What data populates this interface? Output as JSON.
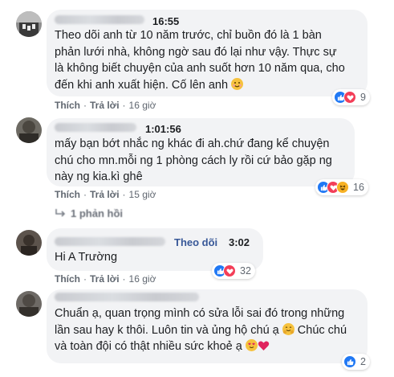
{
  "comments": [
    {
      "time": "16:55",
      "lines": [
        "Theo dõi anh từ 10 năm trước, chỉ buồn đó là 1 bàn",
        "phản lưới nhà, không ngờ sau đó lại như vậy. Thực sự",
        "là không biết chuyện của anh suốt hơn 10 năm qua, cho",
        "đến khi anh xuất hiện. Cố lên anh"
      ],
      "like_label": "Thích",
      "reply_label": "Trả lời",
      "age": "16 giờ",
      "reaction_count": "9",
      "reactions": [
        "like-icon",
        "love-icon"
      ]
    },
    {
      "time": "1:01:56",
      "lines": [
        "mấy bạn bớt nhắc ng khác đi ah.chứ đang kể chuyện",
        "chú cho mn.mỗi ng 1 phòng cách ly rồi cứ bảo gặp ng",
        "này ng kia.kì ghê"
      ],
      "like_label": "Thích",
      "reply_label": "Trả lời",
      "age": "15 giờ",
      "reaction_count": "16",
      "reactions": [
        "like-icon",
        "love-icon",
        "haha-icon"
      ],
      "replies_label": "1 phản hồi"
    },
    {
      "follow_label": "Theo dõi",
      "time": "3:02",
      "lines": [
        "Hi A Trường"
      ],
      "like_label": "Thích",
      "reply_label": "Trả lời",
      "age": "16 giờ",
      "reaction_count": "32",
      "reactions": [
        "like-icon",
        "love-icon"
      ]
    },
    {
      "lines": [
        "Chuẩn ạ, quan trọng mình có sửa lỗi sai đó trong những",
        "lần sau hay k thôi. Luôn tin và ủng hộ chú ạ",
        "và toàn đội có thật nhiều sức khoẻ ạ"
      ],
      "line2_suffix": "Chúc chú",
      "reaction_count": "2",
      "reactions": [
        "like-icon"
      ]
    }
  ],
  "colors": {
    "bubble": "#f2f3f5",
    "link": "#385898",
    "like": "#2078f4",
    "love": "#f33e58",
    "haha": "#f7b125"
  }
}
